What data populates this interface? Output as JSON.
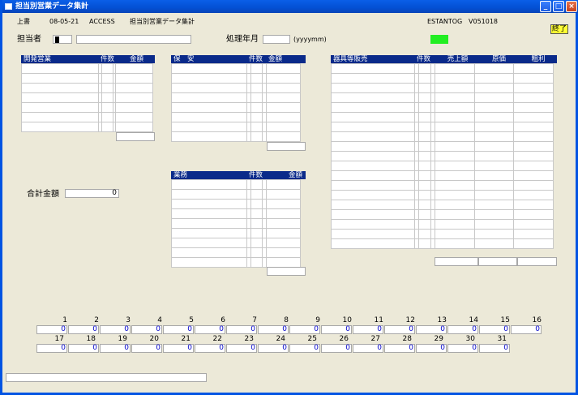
{
  "window": {
    "title": "担当別営業データ集計"
  },
  "header": {
    "mode": "上書",
    "date": "08-05-21",
    "app": "ACCESS",
    "screen_name": "担当別営業データ集計",
    "program_id": "ESTANTOG",
    "version": "V051018",
    "end_button": "終了"
  },
  "form": {
    "tanto_label": "担当者",
    "tanto_code": "",
    "tanto_name": "",
    "year_month_label": "処理年月",
    "year_month_value": "",
    "year_month_hint": "(yyyymm)",
    "total_label": "合計金額",
    "total_value": "0"
  },
  "tables": {
    "kaihatsu": {
      "headers": [
        "開発営業",
        "件数",
        "金額"
      ]
    },
    "hoan": {
      "headers": [
        "保　安",
        "件数",
        "金額"
      ]
    },
    "gyomu": {
      "headers": [
        "業務",
        "件数",
        "金額"
      ]
    },
    "kigu": {
      "headers": [
        "器具等販売",
        "件数",
        "売上額",
        "原価",
        "粗利"
      ]
    }
  },
  "daily": {
    "row1": [
      {
        "day": "1",
        "value": "0"
      },
      {
        "day": "2",
        "value": "0"
      },
      {
        "day": "3",
        "value": "0"
      },
      {
        "day": "4",
        "value": "0"
      },
      {
        "day": "5",
        "value": "0"
      },
      {
        "day": "6",
        "value": "0"
      },
      {
        "day": "7",
        "value": "0"
      },
      {
        "day": "8",
        "value": "0"
      },
      {
        "day": "9",
        "value": "0"
      },
      {
        "day": "10",
        "value": "0"
      },
      {
        "day": "11",
        "value": "0"
      },
      {
        "day": "12",
        "value": "0"
      },
      {
        "day": "13",
        "value": "0"
      },
      {
        "day": "14",
        "value": "0"
      },
      {
        "day": "15",
        "value": "0"
      },
      {
        "day": "16",
        "value": "0"
      }
    ],
    "row2": [
      {
        "day": "17",
        "value": "0"
      },
      {
        "day": "18",
        "value": "0"
      },
      {
        "day": "19",
        "value": "0"
      },
      {
        "day": "20",
        "value": "0"
      },
      {
        "day": "21",
        "value": "0"
      },
      {
        "day": "22",
        "value": "0"
      },
      {
        "day": "23",
        "value": "0"
      },
      {
        "day": "24",
        "value": "0"
      },
      {
        "day": "25",
        "value": "0"
      },
      {
        "day": "26",
        "value": "0"
      },
      {
        "day": "27",
        "value": "0"
      },
      {
        "day": "28",
        "value": "0"
      },
      {
        "day": "29",
        "value": "0"
      },
      {
        "day": "30",
        "value": "0"
      },
      {
        "day": "31",
        "value": "0"
      }
    ]
  },
  "status": {
    "message": ""
  },
  "colors": {
    "titlebar": "#0350d4",
    "table_header": "#0a2a8a",
    "end_button": "#ffff33",
    "indicator": "#22ee22",
    "daily_value": "#0000c8"
  }
}
